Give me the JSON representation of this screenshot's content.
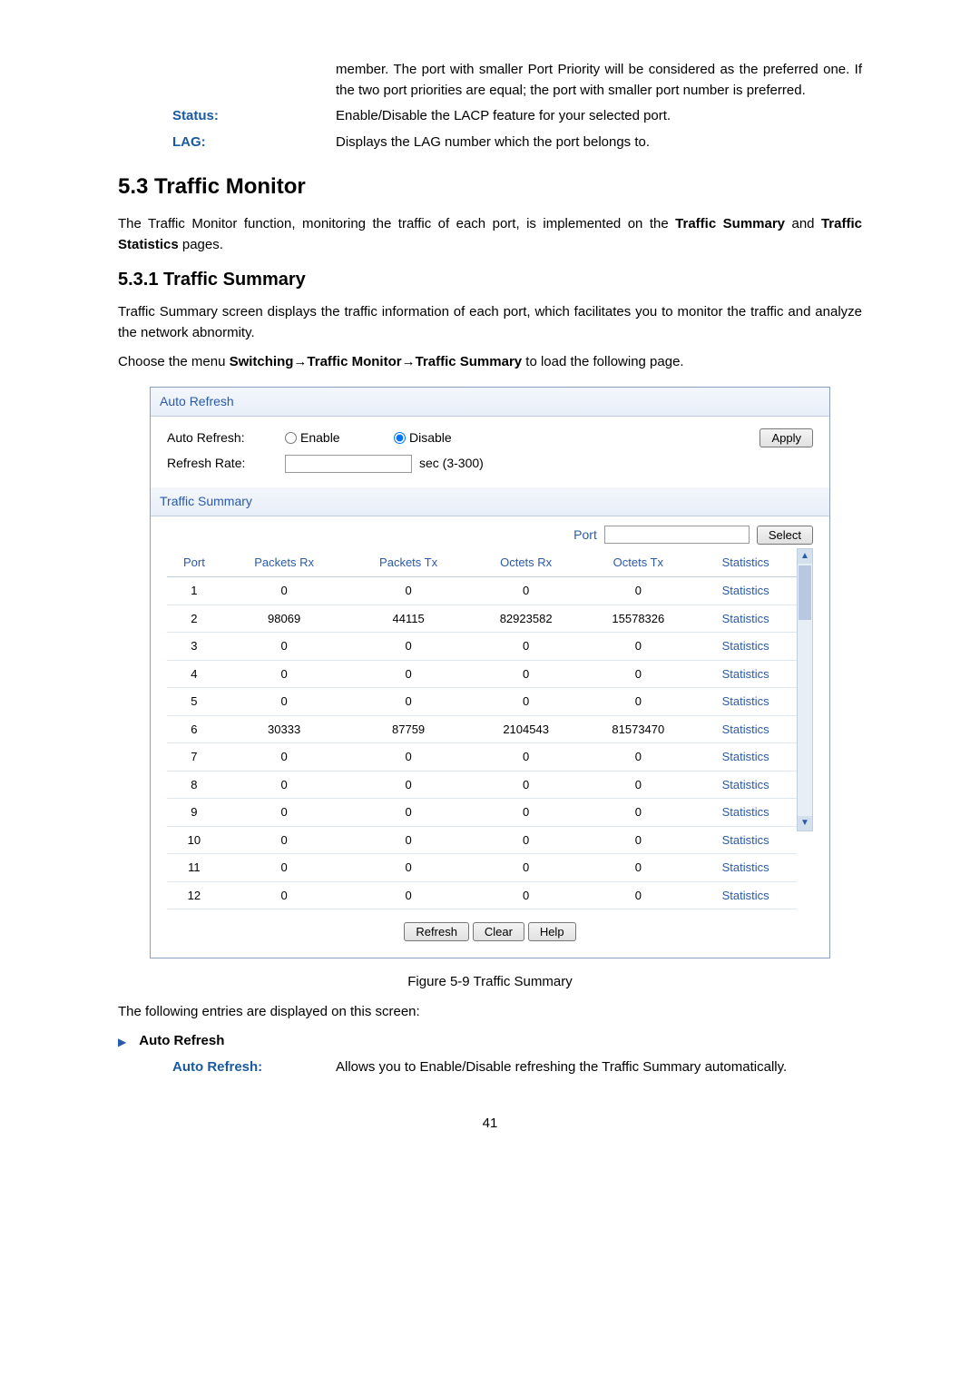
{
  "intro_def_text": "member. The port with smaller Port Priority will be considered as the preferred one. If the two port priorities are equal; the port with smaller port number is preferred.",
  "defs": [
    {
      "label": "Status:",
      "text": "Enable/Disable the LACP feature for your selected port."
    },
    {
      "label": "LAG:",
      "text": "Displays the LAG number which the port belongs to."
    }
  ],
  "sec53_title": "5.3  Traffic Monitor",
  "sec53_intro_a": "The Traffic Monitor function, monitoring the traffic of each port, is implemented on the ",
  "sec53_intro_b": "Traffic Summary",
  "sec53_intro_c": " and ",
  "sec53_intro_d": "Traffic Statistics",
  "sec53_intro_e": " pages.",
  "sec531_title": "5.3.1 Traffic Summary",
  "sec531_p1": "Traffic Summary screen displays the traffic information of each port, which facilitates you to monitor the traffic and analyze the network abnormity.",
  "sec531_p2_a": "Choose the menu ",
  "sec531_p2_b": "Switching→Traffic Monitor→Traffic Summary",
  "sec531_p2_c": " to load the following page.",
  "panel1_title": "Auto Refresh",
  "ar_label": "Auto Refresh:",
  "ar_enable": "Enable",
  "ar_disable": "Disable",
  "rr_label": "Refresh Rate:",
  "rr_suffix": "sec (3-300)",
  "apply_btn": "Apply",
  "panel2_title": "Traffic Summary",
  "port_label": "Port",
  "select_btn": "Select",
  "headers": [
    "Port",
    "Packets Rx",
    "Packets Tx",
    "Octets Rx",
    "Octets Tx",
    "Statistics"
  ],
  "stats_label": "Statistics",
  "rows": [
    {
      "port": "1",
      "prx": "0",
      "ptx": "0",
      "orx": "0",
      "otx": "0"
    },
    {
      "port": "2",
      "prx": "98069",
      "ptx": "44115",
      "orx": "82923582",
      "otx": "15578326"
    },
    {
      "port": "3",
      "prx": "0",
      "ptx": "0",
      "orx": "0",
      "otx": "0"
    },
    {
      "port": "4",
      "prx": "0",
      "ptx": "0",
      "orx": "0",
      "otx": "0"
    },
    {
      "port": "5",
      "prx": "0",
      "ptx": "0",
      "orx": "0",
      "otx": "0"
    },
    {
      "port": "6",
      "prx": "30333",
      "ptx": "87759",
      "orx": "2104543",
      "otx": "81573470"
    },
    {
      "port": "7",
      "prx": "0",
      "ptx": "0",
      "orx": "0",
      "otx": "0"
    },
    {
      "port": "8",
      "prx": "0",
      "ptx": "0",
      "orx": "0",
      "otx": "0"
    },
    {
      "port": "9",
      "prx": "0",
      "ptx": "0",
      "orx": "0",
      "otx": "0"
    },
    {
      "port": "10",
      "prx": "0",
      "ptx": "0",
      "orx": "0",
      "otx": "0"
    },
    {
      "port": "11",
      "prx": "0",
      "ptx": "0",
      "orx": "0",
      "otx": "0"
    },
    {
      "port": "12",
      "prx": "0",
      "ptx": "0",
      "orx": "0",
      "otx": "0"
    }
  ],
  "refresh_btn": "Refresh",
  "clear_btn": "Clear",
  "help_btn": "Help",
  "fig_caption": "Figure 5-9 Traffic Summary",
  "post_text": "The following entries are displayed on this screen:",
  "bullet_label": "Auto Refresh",
  "auto_refresh_def_label": "Auto Refresh:",
  "auto_refresh_def_text": "Allows you to Enable/Disable refreshing the Traffic Summary automatically.",
  "page_num": "41"
}
